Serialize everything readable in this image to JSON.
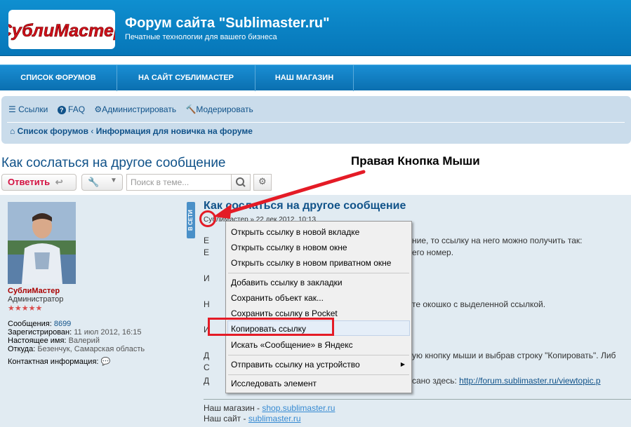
{
  "header": {
    "logo_text": "СублиМастер",
    "title": "Форум сайта \"Sublimaster.ru\"",
    "description": "Печатные технологии для вашего бизнеса"
  },
  "topnav": {
    "items": [
      "СПИСОК ФОРУМОВ",
      "НА САЙТ СУБЛИМАСТЕР",
      "НАШ МАГАЗИН"
    ]
  },
  "navbar": {
    "links": [
      "Ссылки",
      "FAQ",
      "Администрировать",
      "Модерировать"
    ],
    "breadcrumb": [
      "Список форумов",
      "Информация для новичка на форуме"
    ]
  },
  "topic": {
    "title": "Как сослаться на другое сообщение",
    "reply_label": "Ответить",
    "search_placeholder": "Поиск в теме..."
  },
  "annotation": {
    "label": "Правая Кнопка Мыши"
  },
  "author": {
    "name": "СублиМастер",
    "rank": "Администратор",
    "stars": "★★★★★",
    "online": "В СЕТИ",
    "messages_label": "Сообщения:",
    "messages_value": "8699",
    "registered_label": "Зарегистрирован:",
    "registered_value": "11 июл 2012, 16:15",
    "realname_label": "Настоящее имя:",
    "realname_value": "Валерий",
    "from_label": "Откуда:",
    "from_value": "Безенчук, Самарская область",
    "contact_label": "Контактная информация:"
  },
  "post": {
    "title": "Как сослаться на другое сообщение",
    "meta": "СублиМастер » 22 дек 2012, 10:13",
    "lines": [
      "Е",
      "ние, то ссылку на него можно получить так:",
      "Е",
      "его номер.",
      "И",
      "Н",
      "те окошко с выделенной ссылкой.",
      "И",
      "Д",
      "ую кнопку мыши и выбрав строку \"Копировать\". Либ",
      "С",
      "Д",
      "сано здесь:"
    ],
    "link_text": "http://forum.sublimaster.ru/viewtopic.p",
    "signature": {
      "shop_label": "Наш магазин - ",
      "shop_link": "shop.sublimaster.ru",
      "site_label": "Наш сайт - ",
      "site_link": "sublimaster.ru"
    }
  },
  "context_menu": {
    "items": [
      "Открыть ссылку в новой вкладке",
      "Открыть ссылку в новом окне",
      "Открыть ссылку в новом приватном окне",
      "Добавить ссылку в закладки",
      "Сохранить объект как...",
      "Сохранить ссылку в Pocket",
      "Копировать ссылку",
      "Искать «Сообщение» в Яндекс",
      "Отправить ссылку на устройство",
      "Исследовать элемент"
    ],
    "highlighted": "Копировать ссылку"
  },
  "colors": {
    "header_blue": "#0a7fc2",
    "nav_blue": "#0a6fb0",
    "annotation_red": "#e41b26",
    "link_blue": "#105289"
  }
}
